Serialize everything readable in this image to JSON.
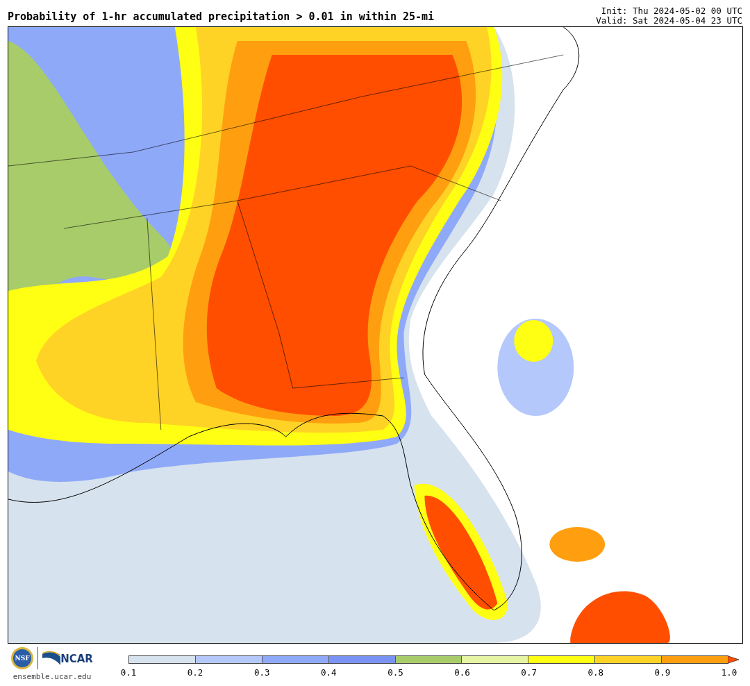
{
  "title": "Probability of 1-hr accumulated precipitation > 0.01 in within 25-mi",
  "init": "Init: Thu 2024-05-02 00 UTC",
  "valid": "Valid: Sat 2024-05-04 23 UTC",
  "logos": {
    "seal_text": "NSF",
    "wordmark": "NCAR",
    "site": "ensemble.ucar.edu"
  },
  "colorbar": {
    "bins": [
      {
        "kind": "bin",
        "color": "#d6e2ed"
      },
      {
        "kind": "bin",
        "color": "#b4c8fb"
      },
      {
        "kind": "bin",
        "color": "#8fa9f9"
      },
      {
        "kind": "bin",
        "color": "#7b92f5"
      },
      {
        "kind": "bin",
        "color": "#a8cc6a"
      },
      {
        "kind": "bin",
        "color": "#e6f5a4"
      },
      {
        "kind": "bin",
        "color": "#ffff14"
      },
      {
        "kind": "bin",
        "color": "#ffd325"
      },
      {
        "kind": "bin",
        "color": "#ff9f0f"
      },
      {
        "kind": "arrow",
        "color": "#ff4e00"
      }
    ],
    "ticks": [
      "0.1",
      "0.2",
      "0.3",
      "0.4",
      "0.5",
      "0.6",
      "0.7",
      "0.8",
      "0.9",
      "1.0"
    ]
  }
}
